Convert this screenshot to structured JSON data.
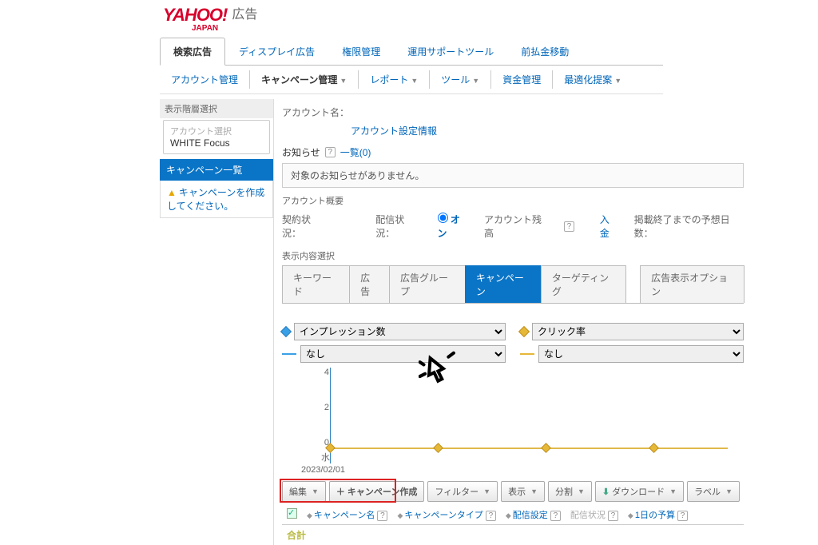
{
  "logo": {
    "brand": "YAHOO!",
    "sub": "JAPAN",
    "suffix": "広告"
  },
  "top_tabs": [
    "検索広告",
    "ディスプレイ広告",
    "権限管理",
    "運用サポートツール",
    "前払金移動"
  ],
  "top_tabs_active": 0,
  "sub_tabs": [
    {
      "label": "アカウント管理",
      "dd": false,
      "bold": false
    },
    {
      "label": "キャンペーン管理",
      "dd": true,
      "bold": true
    },
    {
      "label": "レポート",
      "dd": true,
      "bold": false
    },
    {
      "label": "ツール",
      "dd": true,
      "bold": false
    },
    {
      "label": "資金管理",
      "dd": false,
      "bold": false
    },
    {
      "label": "最適化提案",
      "dd": true,
      "bold": false
    }
  ],
  "sidebar": {
    "hier_label": "表示階層選択",
    "acct_label": "アカウント選択",
    "acct_value": "WHITE Focus",
    "camp_list_hdr": "キャンペーン一覧",
    "camp_warn": "キャンペーンを作成してください。"
  },
  "main": {
    "acct_name_label": "アカウント名：",
    "acct_settings_link": "アカウント設定情報",
    "notice_label": "お知らせ",
    "notice_list_link": "一覧(0)",
    "notice_empty": "対象のお知らせがありません。",
    "overview_label": "アカウント概要",
    "contract_label": "契約状況：",
    "delivery_label": "配信状況：",
    "delivery_value": "オン",
    "balance_label": "アカウント残高",
    "deposit_link": "入金",
    "days_label": "掲載終了までの予想日数：",
    "content_sel_label": "表示内容選択",
    "content_tabs": [
      "キーワード",
      "広告",
      "広告グループ",
      "キャンペーン",
      "ターゲティング",
      "広告表示オプション"
    ],
    "content_active": 3,
    "metric1_opts": "インプレッション数",
    "metric2_opts": "なし",
    "metric3_opts": "クリック率",
    "metric4_opts": "なし",
    "chart_y": {
      "top": "4",
      "mid": "2",
      "bot": "0"
    },
    "chart_day": "水",
    "chart_date": "2023/02/01",
    "toolbar": {
      "edit": "編集",
      "create": "キャンペーン作成",
      "filter": "フィルター",
      "display": "表示",
      "split": "分割",
      "download": "ダウンロード",
      "label": "ラベル"
    },
    "cols": {
      "name": "キャンペーン名",
      "type": "キャンペーンタイプ",
      "deliver": "配信設定",
      "status": "配信状況",
      "budget": "1日の予算"
    },
    "total": "合計"
  },
  "chart_data": {
    "type": "line",
    "x": [
      "2023/02/01"
    ],
    "series": [
      {
        "name": "インプレッション数",
        "values": [
          0
        ]
      },
      {
        "name": "クリック率",
        "values": [
          0
        ]
      }
    ],
    "ylim": [
      0,
      4
    ],
    "ticks": [
      0,
      2,
      4
    ]
  }
}
